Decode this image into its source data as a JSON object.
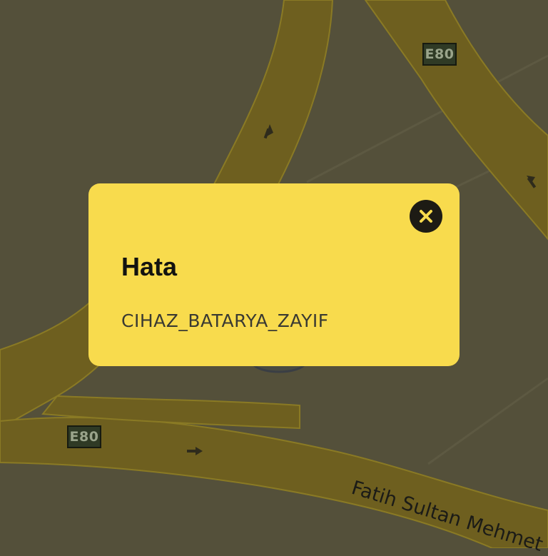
{
  "map": {
    "route_shields": [
      "E80",
      "E80"
    ],
    "street_name": "Fatih Sultan Mehmet",
    "colors": {
      "background": "#54503a",
      "road": "#6e5f1f",
      "road_edge": "#8a7a24",
      "dialog": "#f8db4d"
    }
  },
  "dialog": {
    "title": "Hata",
    "message": "CIHAZ_BATARYA_ZAYIF",
    "close_icon": "close-icon"
  }
}
